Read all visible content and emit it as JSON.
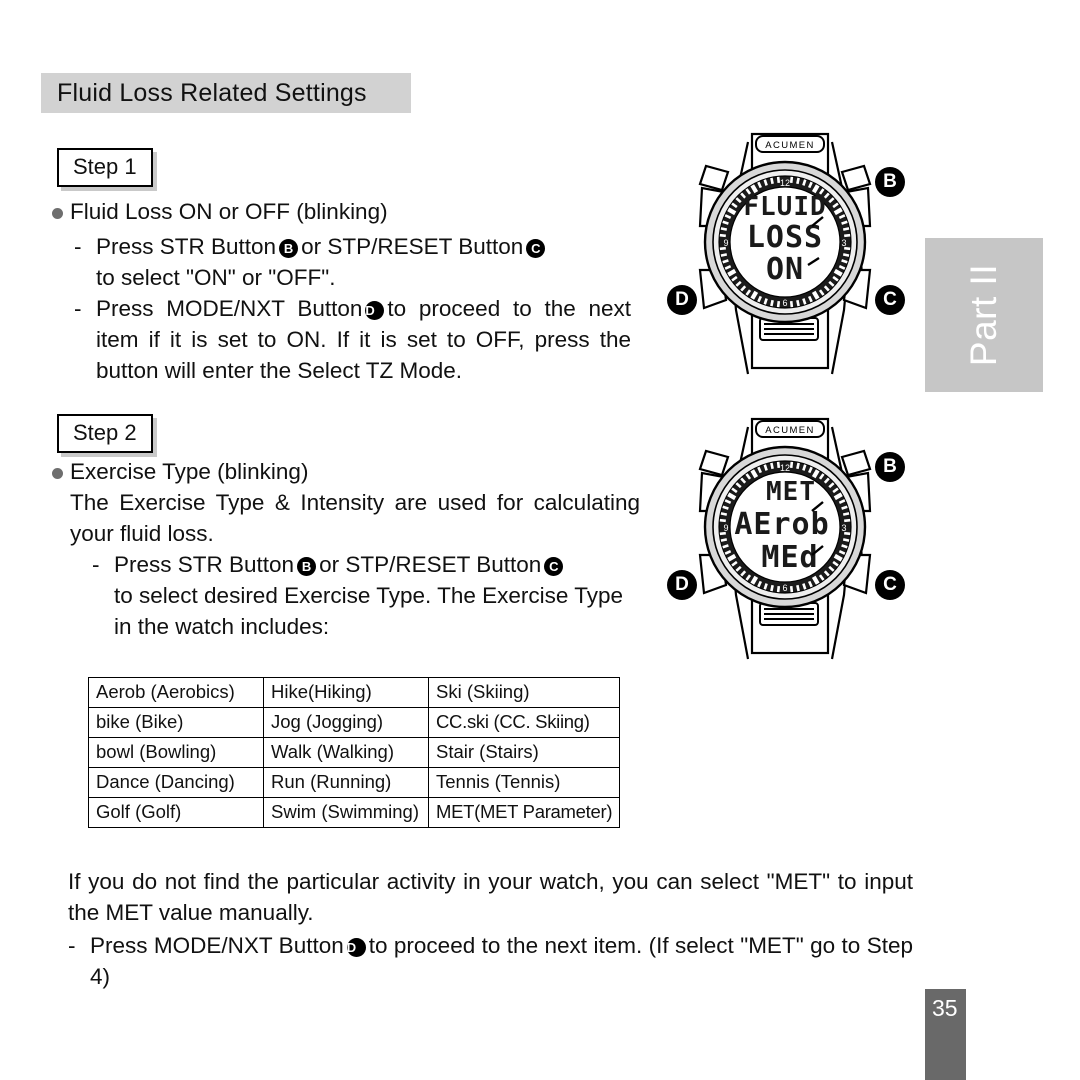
{
  "header": {
    "title": "Fluid Loss Related Settings"
  },
  "side_tab": {
    "label": "Part II"
  },
  "footer": {
    "page_number": "35"
  },
  "steps": [
    {
      "badge": "Step 1",
      "bullet_heading": "Fluid Loss ON or OFF (blinking)",
      "items": [
        {
          "dash": "-",
          "pre": "Press STR Button",
          "badge_1": "B",
          "mid": "or STP/RESET Button",
          "badge_2": "C",
          "post": "to select \"ON\" or  \"OFF\"."
        },
        {
          "dash": "-",
          "pre": "Press MODE/NXT Button",
          "badge_1": "D",
          "post": "to proceed to the next item if it is set to ON. If it is set to OFF, press the button will enter the Select TZ Mode."
        }
      ]
    },
    {
      "badge": "Step 2",
      "bullet_heading": "Exercise Type (blinking)",
      "paragraph": "The Exercise Type & Intensity are used for calculating your fluid loss.",
      "items": [
        {
          "dash": "-",
          "pre": "Press STR Button",
          "badge_1": "B",
          "mid": "or STP/RESET Button",
          "badge_2": "C",
          "post": "to select desired Exercise Type. The Exercise Type in the watch includes:"
        }
      ]
    }
  ],
  "exercise_table": {
    "rows": [
      [
        "Aerob (Aerobics)",
        "Hike(Hiking)",
        "Ski (Skiing)"
      ],
      [
        "bike (Bike)",
        "Jog (Jogging)",
        "CC.ski (CC. Skiing)"
      ],
      [
        "bowl (Bowling)",
        "Walk (Walking)",
        "Stair (Stairs)"
      ],
      [
        "Dance (Dancing)",
        "Run (Running)",
        "Tennis (Tennis)"
      ],
      [
        "Golf (Golf)",
        "Swim (Swimming)",
        "MET(MET Parameter)"
      ]
    ]
  },
  "closing": {
    "paragraph": "If you do not find the particular activity in your watch, you can select \"MET\" to input the MET value manually.",
    "item": {
      "dash": "-",
      "pre": "Press MODE/NXT Button",
      "badge_1": "D",
      "post": "to proceed to the next item. (If select \"MET\" go to Step 4)"
    }
  },
  "watches": [
    {
      "brand": "ACUMEN",
      "display_lines": [
        "FLUID",
        "LOSS",
        "ON"
      ],
      "bezel_top_label": "12",
      "bezel_bottom_label": "6",
      "bezel_left_label": "9",
      "bezel_right_label": "3",
      "markers": {
        "b": "B",
        "c": "C",
        "d": "D"
      }
    },
    {
      "brand": "ACUMEN",
      "display_lines": [
        "MET",
        "AErob",
        "MEd"
      ],
      "bezel_top_label": "12",
      "bezel_bottom_label": "6",
      "bezel_left_label": "9",
      "bezel_right_label": "3",
      "markers": {
        "b": "B",
        "c": "C",
        "d": "D"
      }
    }
  ],
  "colors": {
    "header_bg": "#d2d2d2",
    "side_tab_bg": "#c6c6c6",
    "page_bar_bg": "#696969",
    "bullet": "#6e6e6e",
    "lcd_bg": "#ffffff",
    "bezel_dark": "#1b1b1b",
    "case_gray": "#d8d8d8"
  }
}
